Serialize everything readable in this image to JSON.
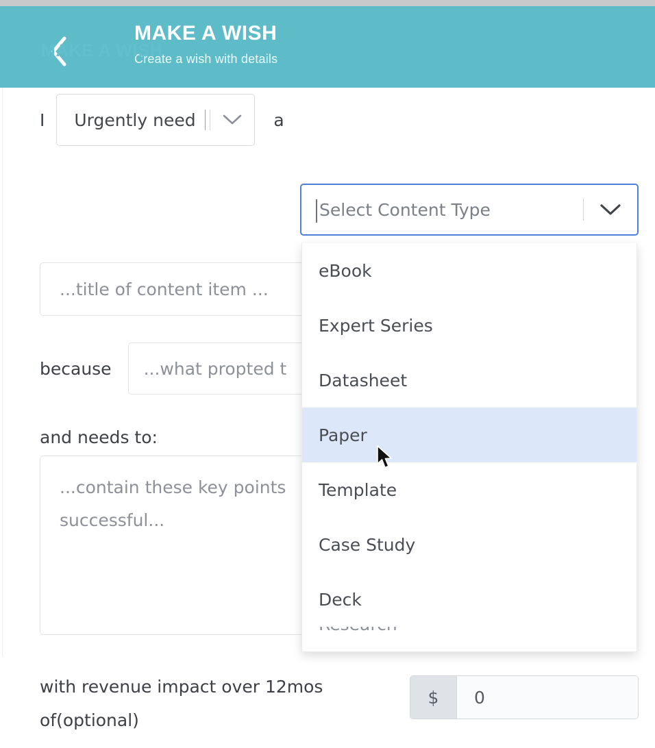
{
  "header": {
    "back_icon": "chevron-left-icon",
    "title": "MAKE A WISH",
    "subtitle": "Create a wish with details",
    "background_color": "#5dbcc8"
  },
  "section": {
    "title": "MAKE A WISH",
    "title_color": "#62c0cc"
  },
  "form": {
    "word_i": "I",
    "word_a": "a",
    "urgency_select": {
      "value": "Urgently need",
      "chevron_icon": "chevron-down-icon"
    },
    "content_type_select": {
      "placeholder": "Select Content Type",
      "chevron_icon": "chevron-down-icon",
      "focused": true,
      "focus_border_color": "#4d7fd6"
    },
    "title_input": {
      "placeholder": "...title of content item ..."
    },
    "because_label": "because",
    "because_input": {
      "placeholder": "...what propted t"
    },
    "needs_label": "and needs to:",
    "needs_textarea": {
      "line1": "...contain these key points",
      "line2": "successful..."
    },
    "revenue_label": "with revenue impact over 12mos of(optional)",
    "money": {
      "prefix": "$",
      "value": "0"
    }
  },
  "dropdown": {
    "highlighted": "Paper",
    "highlight_color": "#dce8fa",
    "options": [
      {
        "label": "eBook",
        "highlighted": false,
        "clipped": false
      },
      {
        "label": "Expert Series",
        "highlighted": false,
        "clipped": false
      },
      {
        "label": "Datasheet",
        "highlighted": false,
        "clipped": false
      },
      {
        "label": "Paper",
        "highlighted": true,
        "clipped": false
      },
      {
        "label": "Template",
        "highlighted": false,
        "clipped": false
      },
      {
        "label": "Case Study",
        "highlighted": false,
        "clipped": false
      },
      {
        "label": "Deck",
        "highlighted": false,
        "clipped": false
      },
      {
        "label": "Research",
        "highlighted": false,
        "clipped": true
      }
    ]
  },
  "cursor": {
    "icon": "mouse-pointer-icon"
  }
}
